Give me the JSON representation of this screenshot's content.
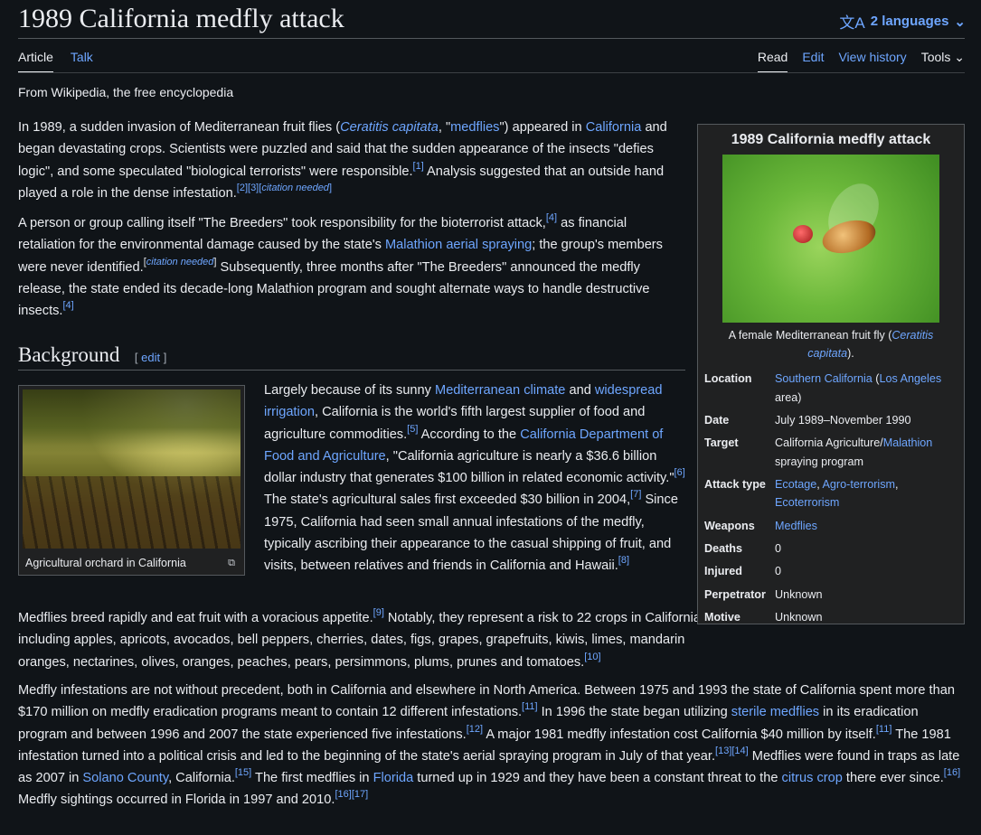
{
  "header": {
    "title": "1989 California medfly attack",
    "languages": "2 languages",
    "tabs_left": [
      "Article",
      "Talk"
    ],
    "tabs_right": [
      "Read",
      "Edit",
      "View history",
      "Tools"
    ],
    "tagline": "From Wikipedia, the free encyclopedia"
  },
  "intro": {
    "p1": {
      "a": "In 1989, a sudden invasion of Mediterranean fruit flies (",
      "l_ceratitis": "Ceratitis capitata",
      "b": ", \"",
      "l_medflies": "medflies",
      "c": "\") appeared in ",
      "l_california": "California",
      "d": " and began devastating crops. Scientists were puzzled and said that the sudden appearance of the insects \"defies logic\", and some speculated \"biological terrorists\" were responsible.",
      "r1": "[1]",
      "e": " Analysis suggested that an outside hand played a role in the dense infestation.",
      "r2": "[2][3][",
      "cn": "citation needed",
      "r2end": "]"
    },
    "p2": {
      "a": "A person or group calling itself \"The Breeders\" took responsibility for the bioterrorist attack,",
      "r4": "[4]",
      "b": " as financial retaliation for the environmental damage caused by the state's ",
      "l_malathion": "Malathion aerial spraying",
      "c": "; the group's members were never identified.",
      "cn_open": "[",
      "cn": "citation needed",
      "cn_close": "]",
      "d": " Subsequently, three months after \"The Breeders\" announced the medfly release, the state ended its decade-long Malathion program and sought alternate ways to handle destructive insects.",
      "r4b": "[4]"
    }
  },
  "background": {
    "heading": "Background",
    "edit_label": "edit",
    "thumb_caption": "Agricultural orchard in California",
    "p1": {
      "a": "Largely because of its sunny ",
      "l_climate": "Mediterranean climate",
      "b": " and ",
      "l_irrigation": "widespread irrigation",
      "c": ", California is the world's fifth largest supplier of food and agriculture commodities.",
      "r5": "[5]",
      "d": " According to the ",
      "l_cdfa": "California Department of Food and Agriculture",
      "e": ", \"California agriculture is nearly a $36.6 billion dollar industry that generates $100 billion in related economic activity.\"",
      "r6": "[6]",
      "f": " The state's agricultural sales first exceeded $30 billion in 2004,",
      "r7": "[7]",
      "g": " Since 1975, California had seen small annual infestations of the medfly, typically ascribing their appearance to the casual shipping of fruit, and visits, between relatives and friends in California and Hawaii.",
      "r8": "[8]"
    },
    "p2": {
      "a": "Medflies breed rapidly and eat fruit with a voracious appetite.",
      "r9": "[9]",
      "b": " Notably, they represent a risk to 22 crops in California, including apples, apricots, avocados, bell peppers, cherries, dates, figs, grapes, grapefruits, kiwis, limes, mandarin oranges, nectarines, olives, oranges, peaches, pears, persimmons, plums, prunes and tomatoes.",
      "r10": "[10]"
    },
    "p3": {
      "a": "Medfly infestations are not without precedent, both in California and elsewhere in North America. Between 1975 and 1993 the state of California spent more than $170 million on medfly eradication programs meant to contain 12 different infestations.",
      "r11": "[11]",
      "b": " In 1996 the state began utilizing ",
      "l_sterile": "sterile medflies",
      "c": " in its eradication program and between 1996 and 2007 the state experienced five infestations.",
      "r12": "[12]",
      "d": " A major 1981 medfly infestation cost California $40 million by itself.",
      "r11b": "[11]",
      "e": " The 1981 infestation turned into a political crisis and led to the beginning of the state's aerial spraying program in July of that year.",
      "r1314": "[13][14]",
      "f": " Medflies were found in traps as late as 2007 in ",
      "l_solano": "Solano County",
      "g": ", California.",
      "r15": "[15]",
      "h": " The first medflies in ",
      "l_florida": "Florida",
      "i": " turned up in 1929 and they have been a constant threat to the ",
      "l_citrus": "citrus crop",
      "j": " there ever since.",
      "r16": "[16]",
      "k": " Medfly sightings occurred in Florida in 1997 and 2010.",
      "r1617": "[16][17]"
    }
  },
  "infobox": {
    "title": "1989 California medfly attack",
    "caption_a": "A female Mediterranean fruit fly (",
    "caption_link": "Ceratitis capitata",
    "caption_b": ").",
    "location_label": "Location",
    "location_link1": "Southern California",
    "location_sep": " (",
    "location_link2": "Los Angeles",
    "location_end": " area)",
    "date_label": "Date",
    "date_value": "July 1989–November 1990",
    "target_label": "Target",
    "target_a": "California Agriculture/",
    "target_link": "Malathion",
    "target_b": " spraying program",
    "attack_label": "Attack type",
    "attack_link1": "Ecotage",
    "attack_sep1": ", ",
    "attack_link2": "Agro-terrorism",
    "attack_sep2": ", ",
    "attack_link3": "Ecoterrorism",
    "weapons_label": "Weapons",
    "weapons_link": "Medflies",
    "deaths_label": "Deaths",
    "deaths_value": "0",
    "injured_label": "Injured",
    "injured_value": "0",
    "perp_label": "Perpetrator",
    "perp_value": "Unknown",
    "motive_label": "Motive",
    "motive_value": "Unknown"
  }
}
